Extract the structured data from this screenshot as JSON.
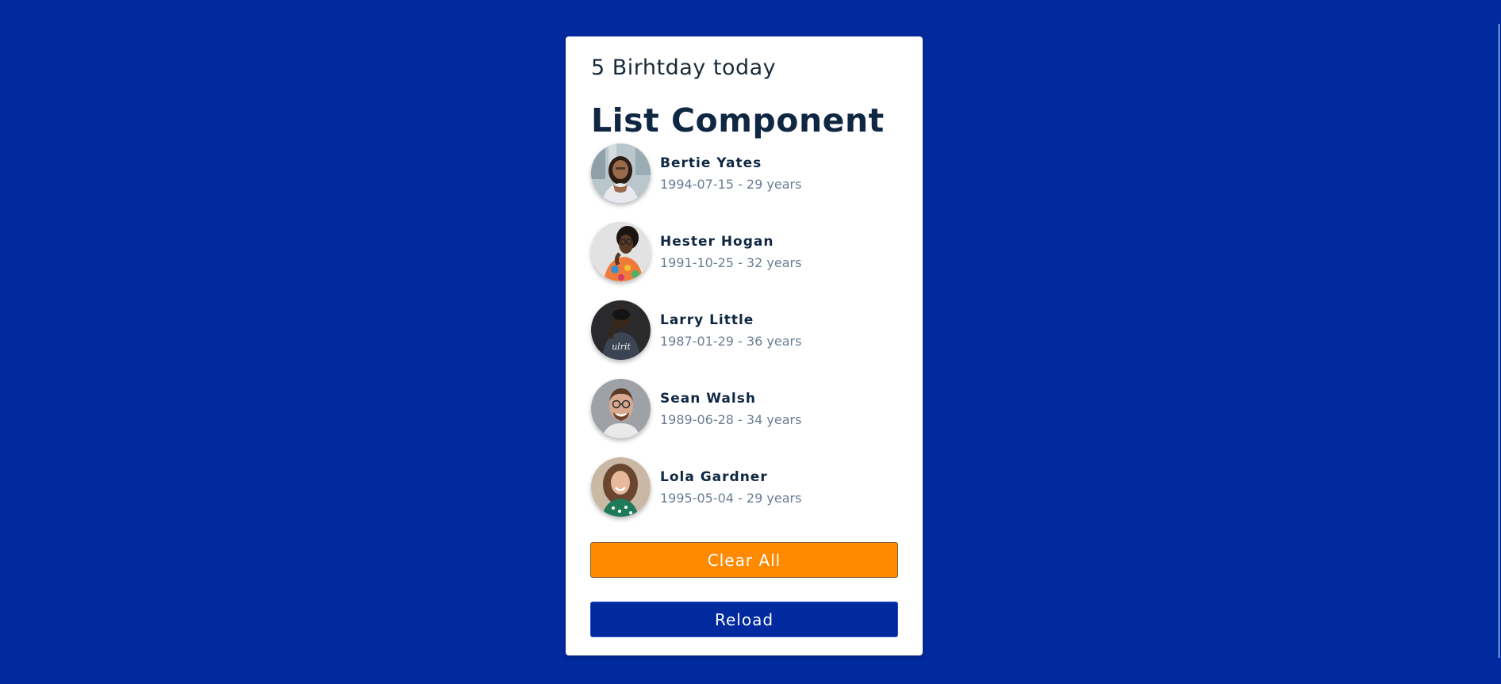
{
  "header": {
    "birthday_count": "5 Birhtday today",
    "title": "List Component"
  },
  "people": [
    {
      "name": "Bertie Yates",
      "meta": "1994-07-15 - 29 years"
    },
    {
      "name": "Hester Hogan",
      "meta": "1991-10-25 - 32 years"
    },
    {
      "name": "Larry Little",
      "meta": "1987-01-29 - 36 years"
    },
    {
      "name": "Sean Walsh",
      "meta": "1989-06-28 - 34 years"
    },
    {
      "name": "Lola Gardner",
      "meta": "1995-05-04 - 29 years"
    }
  ],
  "buttons": {
    "clear_all": "Clear All",
    "reload": "Reload"
  },
  "colors": {
    "background": "#002a9e",
    "card": "#ffffff",
    "clear_button": "#ff8a00",
    "reload_button": "#002a9e",
    "name_text": "#0f2742",
    "meta_text": "#6b7c93"
  }
}
